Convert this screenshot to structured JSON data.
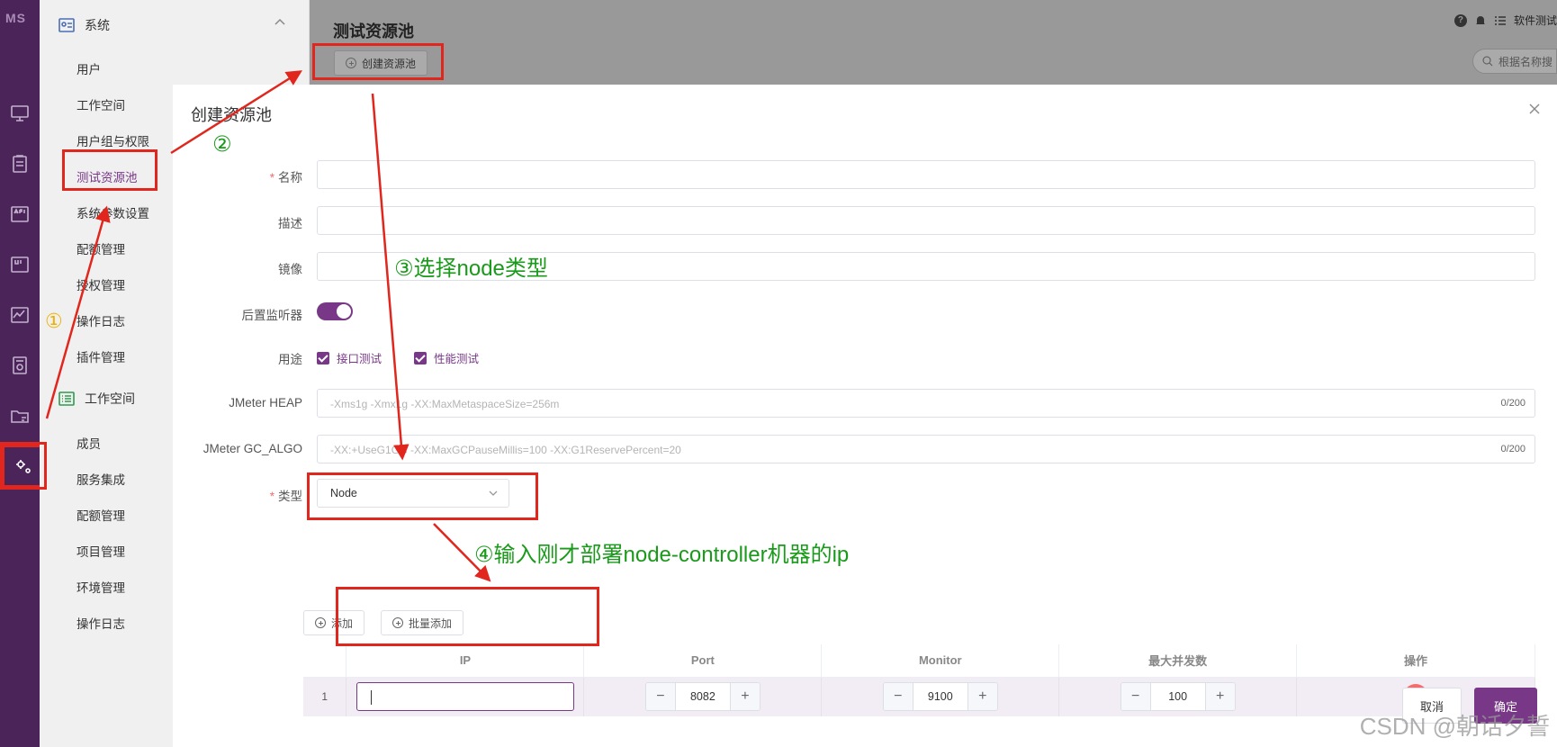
{
  "rail": {
    "logo": "MS",
    "icons": [
      "monitor-icon",
      "clipboard-icon",
      "api-icon",
      "ui-icon",
      "performance-icon",
      "report-icon",
      "folder-icon",
      "settings-icon"
    ]
  },
  "menu": {
    "system_group": "系统",
    "system_items": [
      "用户",
      "工作空间",
      "用户组与权限",
      "测试资源池",
      "系统参数设置",
      "配额管理",
      "授权管理",
      "操作日志",
      "插件管理"
    ],
    "workspace_group": "工作空间",
    "workspace_items": [
      "成员",
      "服务集成",
      "配额管理",
      "项目管理",
      "环境管理",
      "操作日志"
    ]
  },
  "page": {
    "title": "测试资源池",
    "create_button": "创建资源池",
    "search_placeholder": "根据名称搜",
    "user_label": "软件测试"
  },
  "dialog": {
    "title": "创建资源池",
    "fields": {
      "name_label": "名称",
      "desc_label": "描述",
      "image_label": "镜像",
      "listener_label": "后置监听器",
      "usage_label": "用途",
      "usage_options": [
        "接口测试",
        "性能测试"
      ],
      "heap_label": "JMeter HEAP",
      "heap_placeholder": "-Xms1g -Xmx1g -XX:MaxMetaspaceSize=256m",
      "heap_count": "0/200",
      "gc_label": "JMeter GC_ALGO",
      "gc_placeholder": "-XX:+UseG1GC -XX:MaxGCPauseMillis=100 -XX:G1ReservePercent=20",
      "gc_count": "0/200",
      "type_label": "类型",
      "type_value": "Node"
    },
    "add_button": "添加",
    "batch_add_button": "批量添加",
    "table": {
      "headers": [
        "",
        "IP",
        "Port",
        "Monitor",
        "最大并发数",
        "操作"
      ],
      "rows": [
        {
          "index": "1",
          "ip": "",
          "port": "8082",
          "monitor": "9100",
          "max_concurrency": "100"
        }
      ]
    },
    "cancel_button": "取消",
    "confirm_button": "确定"
  },
  "annotations": {
    "step1": "①",
    "step2": "②",
    "step3": "③选择node类型",
    "step4": "④输入刚才部署node-controller机器的ip",
    "color_box": "#e0261d",
    "color_text": "#1a9a1a"
  },
  "watermark": "CSDN @朝话夕誓",
  "colors": {
    "brand": "#783887",
    "rail": "#4b2559",
    "danger": "#f56c6c"
  }
}
